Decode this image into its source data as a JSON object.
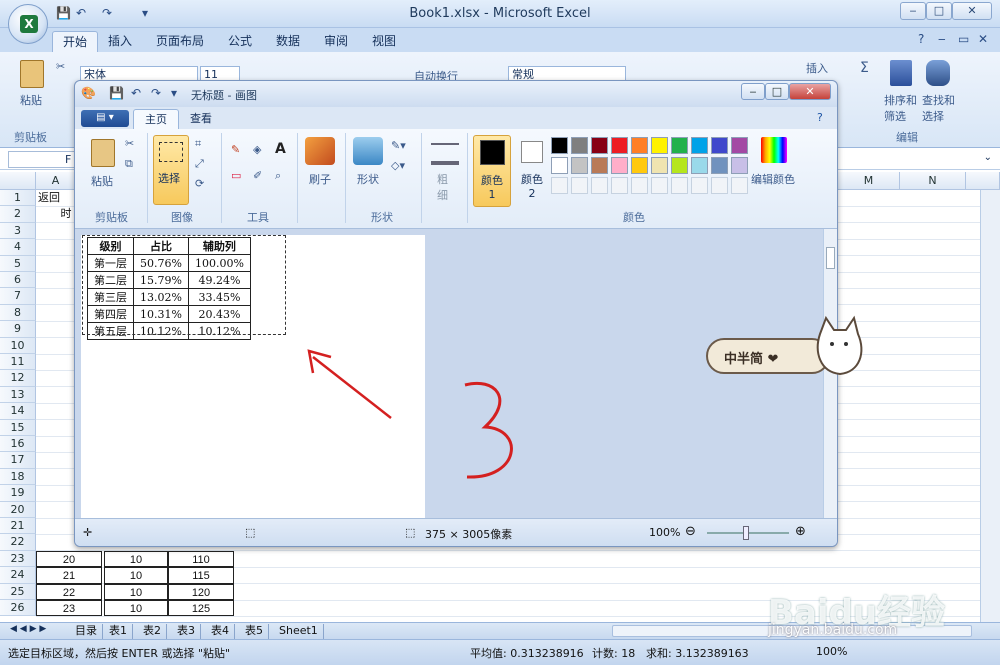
{
  "excel": {
    "title": "Book1.xlsx - Microsoft Excel",
    "tabs": [
      "开始",
      "插入",
      "页面布局",
      "公式",
      "数据",
      "审阅",
      "视图"
    ],
    "ribbon": {
      "paste_label": "粘贴",
      "clipboard_group": "剪贴板",
      "font_name": "宋体",
      "font_size": "11",
      "wrap_label": "自动换行",
      "number_format": "常规",
      "insert_label": "插入",
      "sort_filter_label": "排序和筛选",
      "find_select_label": "查找和选择",
      "edit_group": "编辑",
      "sum_symbol": "Σ"
    },
    "formula_bar": {
      "name_box": "F"
    },
    "col_heads": [
      "A",
      "M",
      "N"
    ],
    "rows": [
      "1",
      "2",
      "3",
      "4",
      "5",
      "6",
      "7",
      "8",
      "9",
      "10",
      "11",
      "12",
      "13",
      "14",
      "15",
      "16",
      "17",
      "18",
      "19",
      "20",
      "21",
      "22",
      "23",
      "24",
      "25",
      "26"
    ],
    "cells": {
      "a1": "返回",
      "a2": "时"
    },
    "visible_data": [
      {
        "a": "20",
        "b": "10",
        "c": "110"
      },
      {
        "a": "21",
        "b": "10",
        "c": "115"
      },
      {
        "a": "22",
        "b": "10",
        "c": "120"
      },
      {
        "a": "23",
        "b": "10",
        "c": "125"
      }
    ],
    "sheet_tabs": [
      "目录",
      "表1",
      "表2",
      "表3",
      "表4",
      "表5",
      "Sheet1"
    ],
    "status": {
      "message": "选定目标区域，然后按 ENTER 或选择 \"粘贴\"",
      "average": "平均值: 0.313238916",
      "count": "计数: 18",
      "sum": "求和: 3.132389163",
      "zoom": "100%"
    }
  },
  "paint": {
    "title": "无标题 - 画图",
    "tabs": [
      "主页",
      "查看"
    ],
    "groups": {
      "clipboard": "剪贴板",
      "image": "图像",
      "tools": "工具",
      "shapes": "形状",
      "colors": "颜色"
    },
    "buttons": {
      "paste": "粘贴",
      "select": "选择",
      "brush": "刷子",
      "shapes": "形状",
      "size": "粗细",
      "color1": "颜色 1",
      "color2": "颜色 2",
      "edit_colors": "编辑颜色"
    },
    "palette_row1": [
      "#000000",
      "#7f7f7f",
      "#880015",
      "#ed1c24",
      "#ff7f27",
      "#fff200",
      "#22b14c",
      "#00a2e8",
      "#3f48cc",
      "#a349a4"
    ],
    "palette_row2": [
      "#ffffff",
      "#c3c3c3",
      "#b97a57",
      "#ffaec9",
      "#ffc90e",
      "#efe4b0",
      "#b5e61d",
      "#99d9ea",
      "#7092be",
      "#c8bfe7"
    ],
    "table": {
      "headers": [
        "级别",
        "占比",
        "辅助列"
      ],
      "rows": [
        [
          "第一层",
          "50.76%",
          "100.00%"
        ],
        [
          "第二层",
          "15.79%",
          "49.24%"
        ],
        [
          "第三层",
          "13.02%",
          "33.45%"
        ],
        [
          "第四层",
          "10.31%",
          "20.43%"
        ],
        [
          "第五层",
          "10.12%",
          "10.12%"
        ]
      ]
    },
    "annotation": "3",
    "status": {
      "size": "375 × 3005像素",
      "zoom": "100%"
    }
  },
  "sticker": {
    "text": "中半简 ❤"
  },
  "watermark": {
    "logo": "Baidu经验",
    "url": "jingyan.baidu.com"
  }
}
